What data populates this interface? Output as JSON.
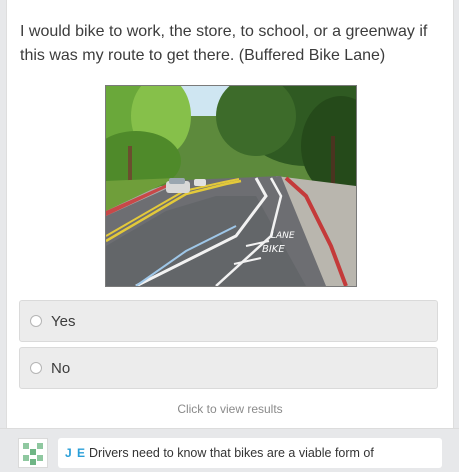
{
  "question": {
    "text": "I would bike to work, the store, to school, or a greenway if this was my route to get there. (Buffered Bike Lane)"
  },
  "photo": {
    "road_markings": [
      "LANE",
      "BIKE"
    ]
  },
  "options": [
    {
      "label": "Yes",
      "selected": false
    },
    {
      "label": "No",
      "selected": false
    }
  ],
  "results_link": "Click to view results",
  "comment": {
    "initials": "J E",
    "text": "Drivers need to know that bikes are a viable form of"
  },
  "colors": {
    "accent": "#2a9fd8",
    "option_bg": "#ececec",
    "page_bg": "#e7e8ea"
  }
}
